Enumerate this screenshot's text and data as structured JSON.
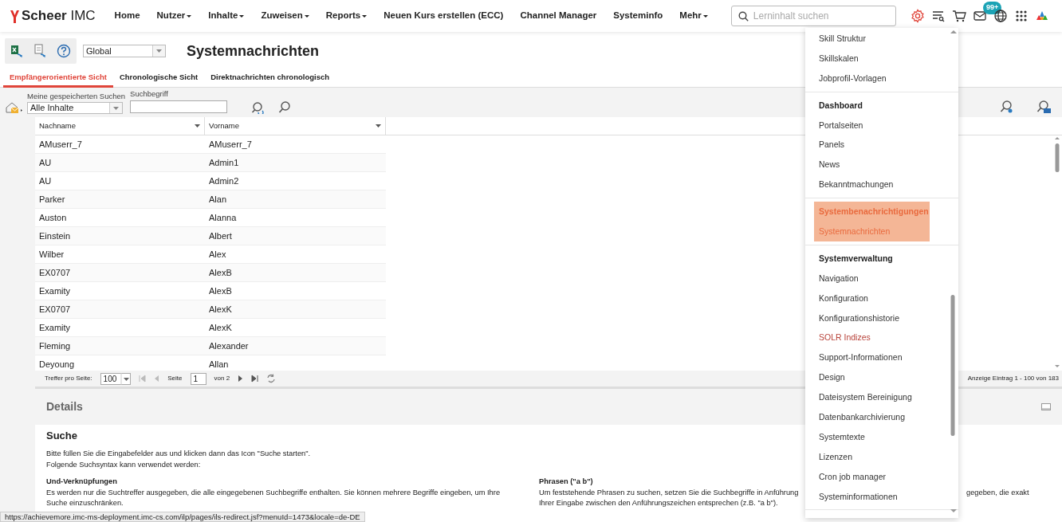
{
  "brand": {
    "logo": "**Scheer** IMC"
  },
  "nav": [
    {
      "label": "Home",
      "dropdown": false
    },
    {
      "label": "Nutzer",
      "dropdown": true
    },
    {
      "label": "Inhalte",
      "dropdown": true
    },
    {
      "label": "Zuweisen",
      "dropdown": true
    },
    {
      "label": "Reports",
      "dropdown": true
    },
    {
      "label": "Neuen Kurs erstellen (ECC)",
      "dropdown": false
    },
    {
      "label": "Channel Manager",
      "dropdown": false
    },
    {
      "label": "Systeminfo",
      "dropdown": false
    },
    {
      "label": "Mehr",
      "dropdown": true
    }
  ],
  "search": {
    "placeholder": "Lerninhalt suchen"
  },
  "header_icons": [
    {
      "kind": "gear",
      "active": true
    },
    {
      "kind": "list-search",
      "active": false
    },
    {
      "kind": "cart",
      "active": false
    },
    {
      "kind": "mail",
      "active": false,
      "badge": "99+"
    },
    {
      "kind": "globe",
      "active": false
    },
    {
      "kind": "apps",
      "active": false
    },
    {
      "kind": "profile",
      "active": false
    }
  ],
  "toolbar": {
    "scope": "Global",
    "title": "Systemnachrichten"
  },
  "tabs": [
    {
      "label": "Empfängerorientierte Sicht",
      "selected": true
    },
    {
      "label": "Chronologische Sicht",
      "selected": false
    },
    {
      "label": "Direktnachrichten chronologisch",
      "selected": false
    }
  ],
  "filter": {
    "saved_label": "Meine gespeicherten Suchen",
    "saved_value": "Alle Inhalte",
    "term_label": "Suchbegriff"
  },
  "table": {
    "columns": [
      "Nachname",
      "Vorname"
    ],
    "rows": [
      [
        "AMuserr_7",
        "AMuserr_7"
      ],
      [
        "AU",
        "Admin1"
      ],
      [
        "AU",
        "Admin2"
      ],
      [
        "Parker",
        "Alan"
      ],
      [
        "Auston",
        "Alanna"
      ],
      [
        "Einstein",
        "Albert"
      ],
      [
        "Wilber",
        "Alex"
      ],
      [
        "EX0707",
        "AlexB"
      ],
      [
        "Examity",
        "AlexB"
      ],
      [
        "EX0707",
        "AlexK"
      ],
      [
        "Examity",
        "AlexK"
      ],
      [
        "Fleming",
        "Alexander"
      ],
      [
        "Deyoung",
        "Allan"
      ]
    ]
  },
  "pager": {
    "per_page_label": "Treffer pro Seite:",
    "per_page": "100",
    "page_label": "Seite",
    "page": "1",
    "of": "von 2",
    "summary": "Anzeige Eintrag 1 - 100 von 183"
  },
  "details": {
    "title": "Details",
    "heading": "Suche",
    "intro": [
      "Bitte füllen Sie die Eingabefelder aus und klicken dann das Icon \"Suche starten\".",
      "Folgende Suchsyntax kann verwendet werden:"
    ],
    "sections": [
      {
        "title": "Und-Verknüpfungen",
        "lines": [
          "Es werden nur die Suchtreffer ausgegeben, die alle eingegebenen Suchbegriffe enthalten. Sie können mehrere Begriffe eingeben, um Ihre",
          "Suche einzuschränken."
        ]
      },
      {
        "title": "Phrasen (\"a b\")",
        "lines": [
          "Um feststehende Phrasen zu suchen, setzen Sie die Suchbegriffe in Anführung",
          "Ihrer Eingabe zwischen den Anführungszeichen entsprechen (z.B. \"a b\")."
        ],
        "tail": "gegeben, die exakt"
      }
    ]
  },
  "menu": {
    "groups": [
      [
        {
          "label": "Skill Struktur",
          "kind": "item",
          "selected": false,
          "hovered": false
        },
        {
          "label": "Skillskalen",
          "kind": "item",
          "selected": false,
          "hovered": false
        },
        {
          "label": "Jobprofil-Vorlagen",
          "kind": "item",
          "selected": false,
          "hovered": false
        }
      ],
      [
        {
          "label": "Dashboard",
          "kind": "header",
          "selected": false,
          "hovered": false
        },
        {
          "label": "Portalseiten",
          "kind": "item",
          "selected": false,
          "hovered": false
        },
        {
          "label": "Panels",
          "kind": "item",
          "selected": false,
          "hovered": false
        },
        {
          "label": "News",
          "kind": "item",
          "selected": false,
          "hovered": false
        },
        {
          "label": "Bekanntmachungen",
          "kind": "item",
          "selected": false,
          "hovered": false
        }
      ],
      [
        {
          "label": "Systembenachrichtigungen",
          "kind": "header",
          "selected": true,
          "hovered": false
        },
        {
          "label": "Systemnachrichten",
          "kind": "item",
          "selected": true,
          "hovered": false
        }
      ],
      [
        {
          "label": "Systemverwaltung",
          "kind": "header",
          "selected": false,
          "hovered": false
        },
        {
          "label": "Navigation",
          "kind": "item",
          "selected": false,
          "hovered": false
        },
        {
          "label": "Konfiguration",
          "kind": "item",
          "selected": false,
          "hovered": false
        },
        {
          "label": "Konfigurationshistorie",
          "kind": "item",
          "selected": false,
          "hovered": false
        },
        {
          "label": "SOLR Indizes",
          "kind": "item",
          "selected": false,
          "hovered": true
        },
        {
          "label": "Support-Informationen",
          "kind": "item",
          "selected": false,
          "hovered": false
        },
        {
          "label": "Design",
          "kind": "item",
          "selected": false,
          "hovered": false
        },
        {
          "label": "Dateisystem Bereinigung",
          "kind": "item",
          "selected": false,
          "hovered": false
        },
        {
          "label": "Datenbankarchivierung",
          "kind": "item",
          "selected": false,
          "hovered": false
        },
        {
          "label": "Systemtexte",
          "kind": "item",
          "selected": false,
          "hovered": false
        },
        {
          "label": "Lizenzen",
          "kind": "item",
          "selected": false,
          "hovered": false
        },
        {
          "label": "Cron job manager",
          "kind": "item",
          "selected": false,
          "hovered": false
        },
        {
          "label": "Systeminformationen",
          "kind": "item",
          "selected": false,
          "hovered": false
        }
      ]
    ]
  },
  "status_url": "https://achievemore.imc-ms-deployment.imc-cs.com/ilp/pages/ils-redirect.jsf?menuId=1473&locale=de-DE"
}
